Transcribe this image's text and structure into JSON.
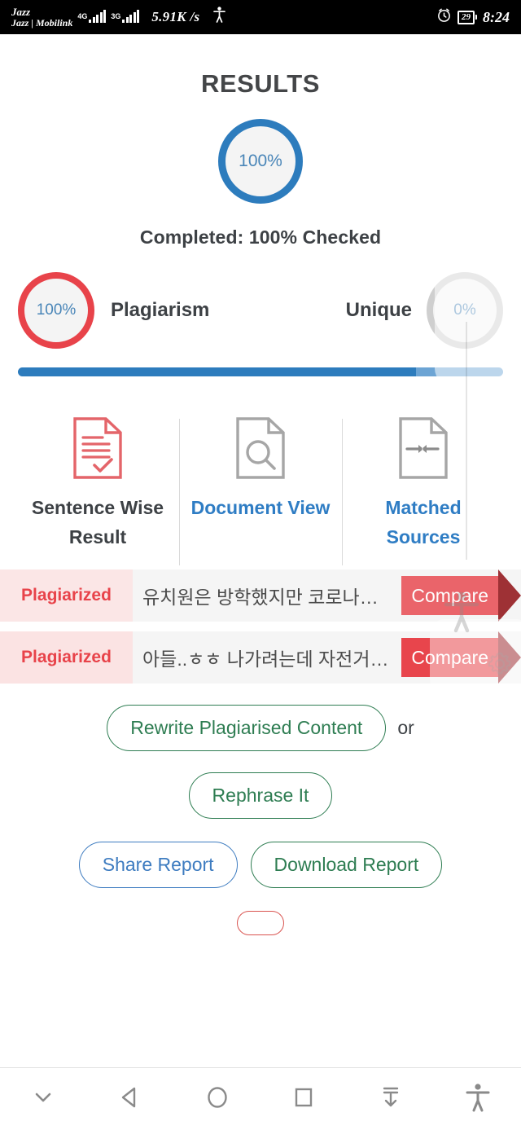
{
  "statusbar": {
    "carrier_line1": "Jazz",
    "carrier_line2": "Jazz | Mobilink",
    "net_tag_1": "4G",
    "net_tag_2": "3G",
    "net_speed": "5.91K /s",
    "accessibility_icon": "accessibility-icon",
    "alarm_icon": "alarm-clock-icon",
    "battery_level": "29",
    "time": "8:24"
  },
  "page": {
    "title": "RESULTS",
    "main_ring_value": "100%",
    "completed_text": "Completed: 100% Checked",
    "plagiarism_value": "100%",
    "plagiarism_label": "Plagiarism",
    "unique_label": "Unique",
    "unique_value": "0%",
    "progress_percent": 82
  },
  "colors": {
    "blue": "#2d7cbd",
    "red": "#e8434a",
    "green": "#2e7d52",
    "gray_ring": "#cfcfcf",
    "tag_bg": "#fbe3e3",
    "snippet_bg": "#f5f5f5"
  },
  "tabs": [
    {
      "label": "Sentence Wise Result",
      "icon": "document-check-icon",
      "state": "active"
    },
    {
      "label": "Document View",
      "icon": "document-search-icon",
      "state": "inactive"
    },
    {
      "label": "Matched Sources",
      "icon": "document-arrows-icon",
      "state": "inactive"
    }
  ],
  "results": {
    "rows": [
      {
        "tag": "Plagiarized",
        "snippet": "유치원은 방학했지만 코로나…",
        "compare_label": "Compare"
      },
      {
        "tag": "Plagiarized",
        "snippet": "아들..ㅎㅎ 나가려는데 자전거…",
        "compare_label": "Compare"
      }
    ]
  },
  "actions": {
    "rewrite": "Rewrite Plagiarised Content",
    "or": "or",
    "rephrase": "Rephrase It",
    "share": "Share Report",
    "download": "Download Report",
    "partial_bottom": ""
  },
  "floating": {
    "accessibility_icon": "accessibility-icon",
    "gear_icon": "gear-icon"
  },
  "navbar": [
    {
      "icon": "chevron-down-icon",
      "name": "hide-keyboard-button"
    },
    {
      "icon": "back-triangle-icon",
      "name": "back-button"
    },
    {
      "icon": "circle-icon",
      "name": "home-button"
    },
    {
      "icon": "square-icon",
      "name": "recents-button"
    },
    {
      "icon": "download-arrow-icon",
      "name": "download-button"
    },
    {
      "icon": "accessibility-icon",
      "name": "accessibility-button"
    }
  ]
}
